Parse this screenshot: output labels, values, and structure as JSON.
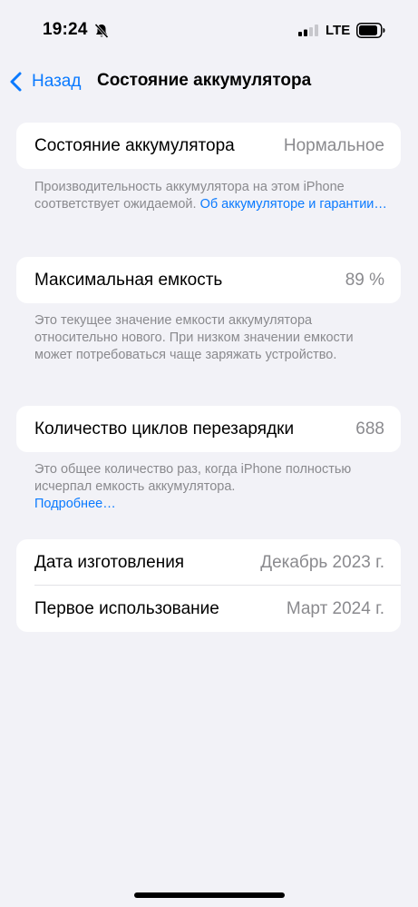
{
  "status_bar": {
    "time": "19:24",
    "network": "LTE",
    "icons": [
      "bell-slash-icon",
      "signal-icon",
      "battery-icon"
    ]
  },
  "nav": {
    "back_label": "Назад",
    "title": "Состояние аккумулятора"
  },
  "sections": {
    "health": {
      "label": "Состояние аккумулятора",
      "value": "Нормальное",
      "note_text": "Производительность аккумулятора на этом iPhone соответствует ожидаемой. ",
      "note_link": "Об аккумуляторе и гарантии…"
    },
    "capacity": {
      "label": "Максимальная емкость",
      "value": "89 %",
      "note_text": "Это текущее значение емкости аккумулятора относительно нового. При низком значении емкости может потребоваться чаще заряжать устройство."
    },
    "cycles": {
      "label": "Количество циклов перезарядки",
      "value": "688",
      "note_text": "Это общее количество раз, когда iPhone полностью исчерпал емкость аккумулятора.",
      "note_link": "Подробнее…"
    },
    "dates": {
      "manufactured_label": "Дата изготовления",
      "manufactured_value": "Декабрь 2023 г.",
      "first_use_label": "Первое использование",
      "first_use_value": "Март 2024 г."
    }
  },
  "colors": {
    "background": "#f2f2f7",
    "accent": "#0a7aff",
    "secondary_text": "#8a8a8e"
  }
}
